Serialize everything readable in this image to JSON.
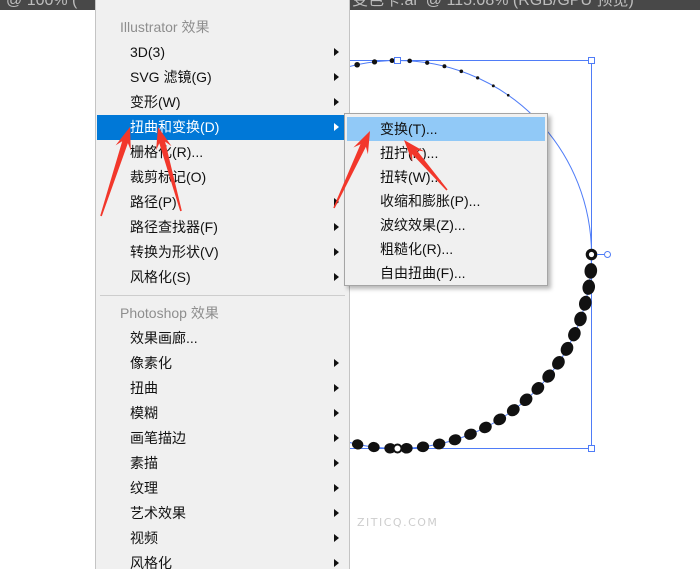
{
  "title_bar": {
    "left_text": "@ 100% (",
    "right_text": "变色卡.ai  @ 115.08% (RGB/GPU 预览)"
  },
  "effect_menu": {
    "sections": [
      {
        "header": "Illustrator 效果",
        "items": [
          {
            "label": "3D(3)",
            "submenu": true,
            "highlighted": false
          },
          {
            "label": "SVG 滤镜(G)",
            "submenu": true,
            "highlighted": false
          },
          {
            "label": "变形(W)",
            "submenu": true,
            "highlighted": false
          },
          {
            "label": "扭曲和变换(D)",
            "submenu": true,
            "highlighted": true
          },
          {
            "label": "栅格化(R)...",
            "submenu": false,
            "highlighted": false
          },
          {
            "label": "裁剪标记(O)",
            "submenu": false,
            "highlighted": false
          },
          {
            "label": "路径(P)",
            "submenu": true,
            "highlighted": false
          },
          {
            "label": "路径查找器(F)",
            "submenu": true,
            "highlighted": false
          },
          {
            "label": "转换为形状(V)",
            "submenu": true,
            "highlighted": false
          },
          {
            "label": "风格化(S)",
            "submenu": true,
            "highlighted": false
          }
        ]
      },
      {
        "header": "Photoshop 效果",
        "items": [
          {
            "label": "效果画廊...",
            "submenu": false,
            "highlighted": false
          },
          {
            "label": "像素化",
            "submenu": true,
            "highlighted": false
          },
          {
            "label": "扭曲",
            "submenu": true,
            "highlighted": false
          },
          {
            "label": "模糊",
            "submenu": true,
            "highlighted": false
          },
          {
            "label": "画笔描边",
            "submenu": true,
            "highlighted": false
          },
          {
            "label": "素描",
            "submenu": true,
            "highlighted": false
          },
          {
            "label": "纹理",
            "submenu": true,
            "highlighted": false
          },
          {
            "label": "艺术效果",
            "submenu": true,
            "highlighted": false
          },
          {
            "label": "视频",
            "submenu": true,
            "highlighted": false
          },
          {
            "label": "风格化",
            "submenu": true,
            "highlighted": false
          }
        ]
      }
    ]
  },
  "distort_transform_submenu": {
    "items": [
      {
        "label": "变换(T)...",
        "highlighted": true
      },
      {
        "label": "扭拧(K)...",
        "highlighted": false
      },
      {
        "label": "扭转(W)...",
        "highlighted": false
      },
      {
        "label": "收缩和膨胀(P)...",
        "highlighted": false
      },
      {
        "label": "波纹效果(Z)...",
        "highlighted": false
      },
      {
        "label": "粗糙化(R)...",
        "highlighted": false
      },
      {
        "label": "自由扭曲(F)...",
        "highlighted": false
      }
    ]
  },
  "watermark": "ZITICQ.COM",
  "icons": {
    "submenu_arrow": "submenu-arrow-icon"
  },
  "colors": {
    "menu_highlight": "#0078d7",
    "submenu_highlight": "#91c9f7",
    "selection": "#4f7cf7",
    "annotation_arrow": "#f2372b",
    "artwork_dots": "#111111"
  }
}
